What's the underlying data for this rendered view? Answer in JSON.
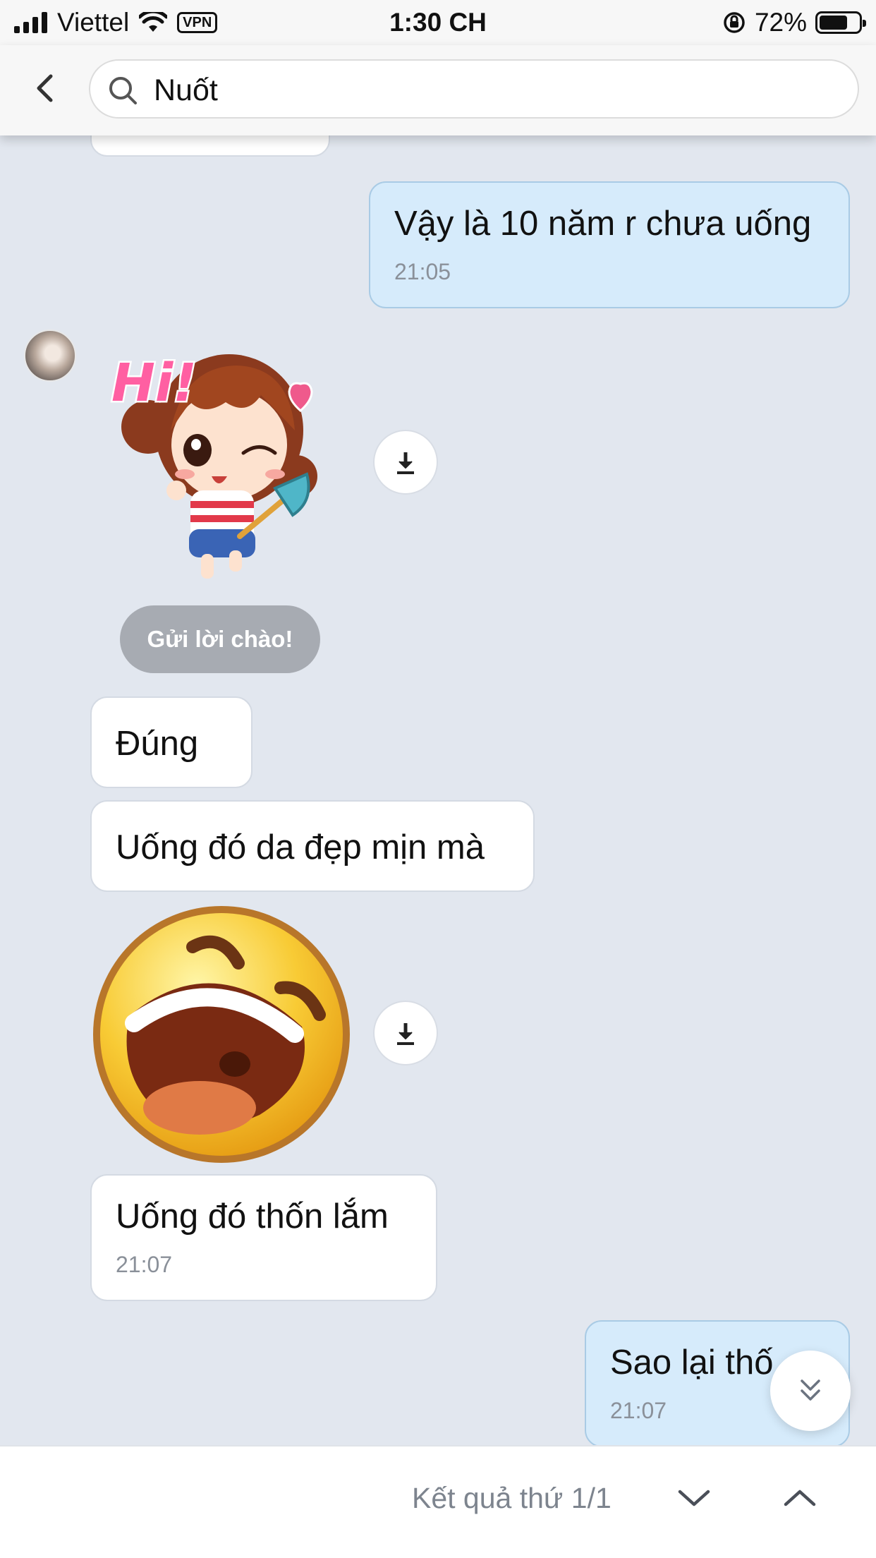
{
  "status_bar": {
    "carrier": "Viettel",
    "vpn": "VPN",
    "time": "1:30 CH",
    "battery": "72%",
    "battery_level": 0.72
  },
  "header": {
    "search_value": "Nuốt"
  },
  "messages": [
    {
      "text": "Vậy là 10 năm r chưa uống",
      "time": "21:05",
      "direction": "sent"
    },
    {
      "sticker": "hi-girl-sticker",
      "text": "Hi!",
      "direction": "received"
    },
    {
      "text": "Đúng",
      "direction": "received"
    },
    {
      "text": "Uống đó da đẹp mịn mà",
      "direction": "received"
    },
    {
      "sticker": "laughing-emoji-sticker",
      "direction": "received"
    },
    {
      "text": "Uống đó thốn lắm",
      "time": "21:07",
      "direction": "received"
    },
    {
      "text": "Sao lại thố",
      "time": "21:07",
      "direction": "sent"
    }
  ],
  "hello_chip": "Gửi lời chào!",
  "bottom_bar": {
    "result": "Kết quả thứ 1/1"
  },
  "colors": {
    "chat_background": "#e2e7ef",
    "sent_bubble": "#d6ebfb",
    "received_bubble": "#ffffff"
  }
}
